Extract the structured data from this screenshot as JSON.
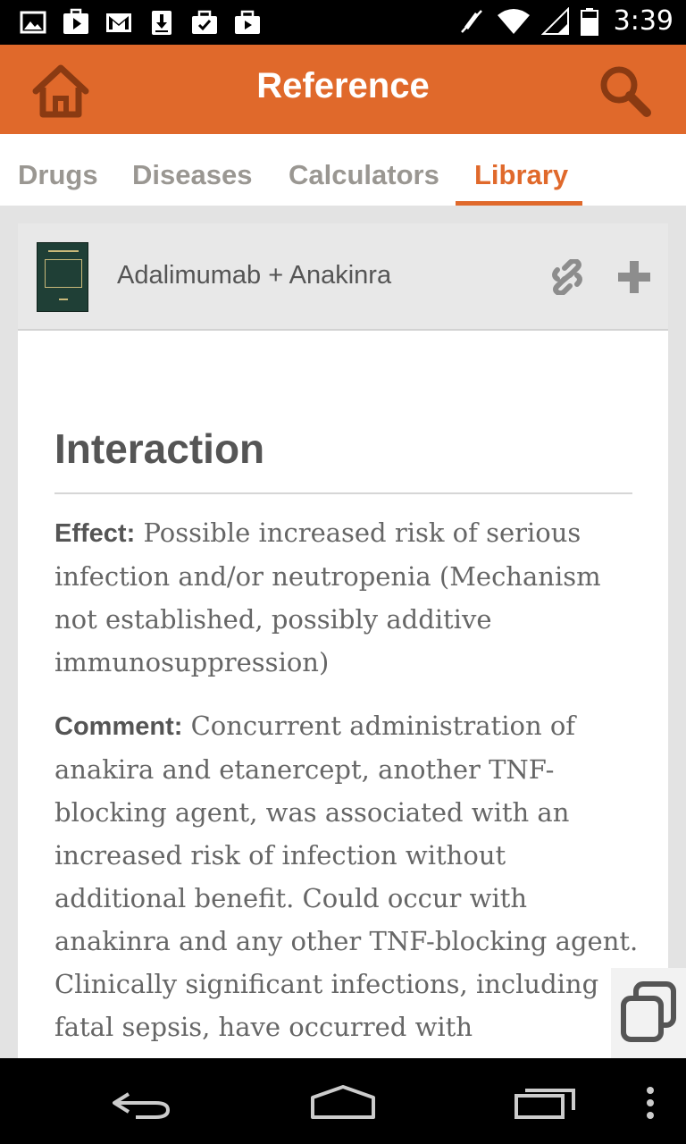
{
  "status_bar": {
    "time": "3:39",
    "left_icons": [
      "image-icon",
      "play-store-icon",
      "gmail-icon",
      "download-icon",
      "play-store-update-icon",
      "play-store-update-icon"
    ],
    "right_icons": [
      "mute-icon",
      "wifi-icon",
      "signal-icon",
      "battery-icon"
    ]
  },
  "app_bar": {
    "title": "Reference",
    "home_icon": "home-icon",
    "search_icon": "search-icon",
    "color": "#e0692b"
  },
  "tabs": [
    {
      "label": "Drugs",
      "active": false
    },
    {
      "label": "Diseases",
      "active": false
    },
    {
      "label": "Calculators",
      "active": false
    },
    {
      "label": "Library",
      "active": true
    }
  ],
  "card": {
    "title": "Adalimumab + Anakinra",
    "actions": [
      "link-icon",
      "add-icon"
    ]
  },
  "content": {
    "heading": "Interaction",
    "effect_label": "Effect:",
    "effect_text": "Possible increased risk of serious infection and/or neutropenia (Mechanism not established, possibly additive immunosuppression)",
    "comment_label": "Comment:",
    "comment_text": "Concurrent administration of anakira and etanercept, another TNF-blocking agent, was associated with an increased risk of infection without additional benefit. Could occur with anakinra and any other TNF-blocking agent. Clinically significant infections, including fatal sepsis, have occurred with"
  },
  "floating_button": {
    "icon": "copy-windows-icon"
  },
  "nav_bar": {
    "icons": [
      "back-icon",
      "home-nav-icon",
      "recents-icon",
      "menu-icon"
    ]
  }
}
